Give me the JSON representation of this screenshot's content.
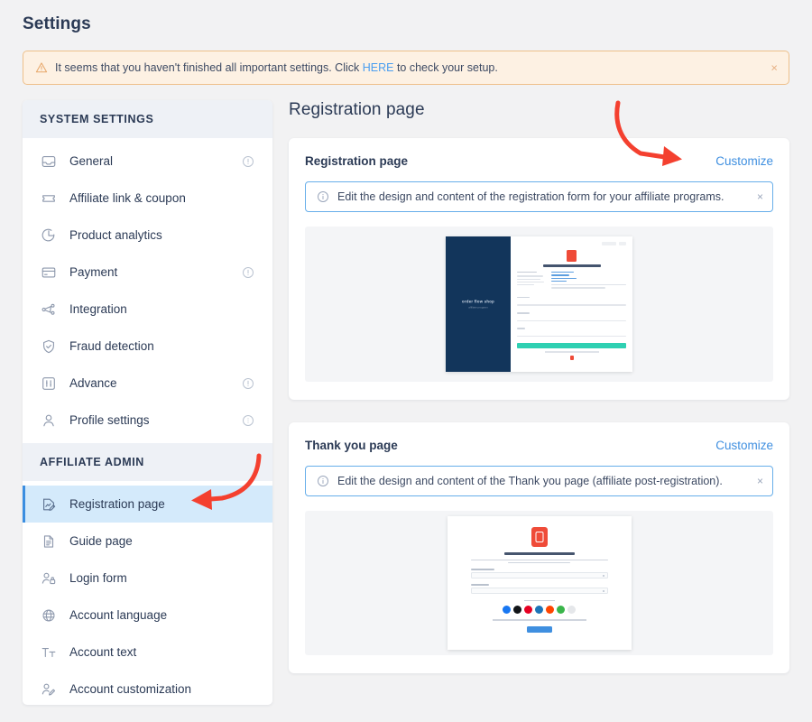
{
  "page_title": "Settings",
  "alert": {
    "icon": "warning-triangle-icon",
    "text_before": "It seems that you haven't finished all important settings. Click ",
    "link_label": "HERE",
    "text_after": " to check your setup.",
    "close_label": "×",
    "bg_color": "#fdf1e3",
    "border_color": "#eec08a"
  },
  "sidebar": {
    "sections": [
      {
        "label": "SYSTEM SETTINGS",
        "items": [
          {
            "label": "General",
            "icon": "inbox-tray-icon",
            "has_info": true,
            "active": false
          },
          {
            "label": "Affiliate link & coupon",
            "icon": "ticket-icon",
            "has_info": false,
            "active": false
          },
          {
            "label": "Product analytics",
            "icon": "pie-chart-icon",
            "has_info": false,
            "active": false
          },
          {
            "label": "Payment",
            "icon": "credit-card-icon",
            "has_info": true,
            "active": false
          },
          {
            "label": "Integration",
            "icon": "nodes-network-icon",
            "has_info": false,
            "active": false
          },
          {
            "label": "Fraud detection",
            "icon": "shield-check-icon",
            "has_info": false,
            "active": false
          },
          {
            "label": "Advance",
            "icon": "sliders-box-icon",
            "has_info": true,
            "active": false
          },
          {
            "label": "Profile settings",
            "icon": "user-icon",
            "has_info": true,
            "active": false
          }
        ]
      },
      {
        "label": "AFFILIATE ADMIN",
        "items": [
          {
            "label": "Registration page",
            "icon": "document-edit-icon",
            "has_info": false,
            "active": true
          },
          {
            "label": "Guide page",
            "icon": "file-lines-icon",
            "has_info": false,
            "active": false
          },
          {
            "label": "Login form",
            "icon": "user-lock-icon",
            "has_info": false,
            "active": false
          },
          {
            "label": "Account language",
            "icon": "globe-icon",
            "has_info": false,
            "active": false
          },
          {
            "label": "Account text",
            "icon": "text-format-icon",
            "has_info": false,
            "active": false
          },
          {
            "label": "Account customization",
            "icon": "user-pencil-icon",
            "has_info": false,
            "active": false
          }
        ]
      }
    ],
    "active_bg_color": "#d4eafb",
    "active_bar_color": "#3b8ee0"
  },
  "main": {
    "title": "Registration page",
    "cards": [
      {
        "title": "Registration page",
        "action_label": "Customize",
        "note_icon": "info-circle-icon",
        "note_text": "Edit the design and content of the registration form for your affiliate programs.",
        "note_close_label": "×",
        "preview_name": "registration-page-preview"
      },
      {
        "title": "Thank you page",
        "action_label": "Customize",
        "note_icon": "info-circle-icon",
        "note_text": "Edit the design and content of the Thank you page (affiliate post-registration).",
        "note_close_label": "×",
        "preview_name": "thank-you-page-preview"
      }
    ]
  },
  "annotations": {
    "arrow_color": "#f4402f",
    "arrows": [
      {
        "name": "arrow-pointing-to-customize",
        "target": "Customize"
      },
      {
        "name": "arrow-pointing-to-registration-page",
        "target": "Registration page"
      }
    ]
  },
  "preview_colors": {
    "registration_panel": "#12355b",
    "registration_button": "#2fd0b2",
    "logo_red": "#ef4b38",
    "thankyou_cta": "#3f8fe0",
    "socials": [
      "#1877f2",
      "#111418",
      "#e60023",
      "#1d74b8",
      "#ff4500",
      "#3ab54a",
      "#e5e7ea"
    ]
  },
  "link_color": "#3f8fe0"
}
